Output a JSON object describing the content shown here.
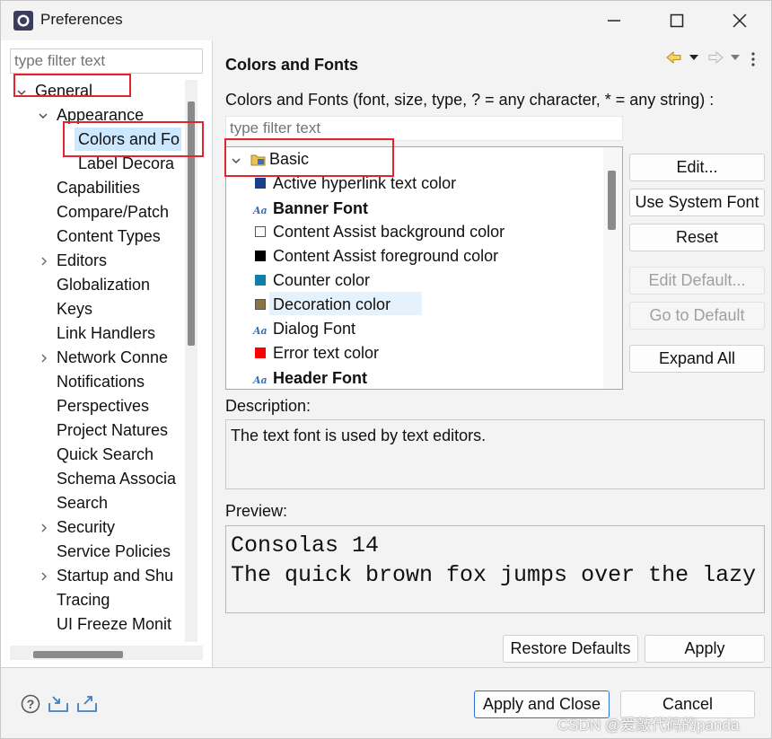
{
  "window": {
    "title": "Preferences"
  },
  "left": {
    "filter_placeholder": "type filter text",
    "tree": [
      {
        "label": "General"
      },
      {
        "label": "Appearance"
      },
      {
        "label": "Colors and Fo"
      },
      {
        "label": "Label Decora"
      },
      {
        "label": "Capabilities"
      },
      {
        "label": "Compare/Patch"
      },
      {
        "label": "Content Types"
      },
      {
        "label": "Editors"
      },
      {
        "label": "Globalization"
      },
      {
        "label": "Keys"
      },
      {
        "label": "Link Handlers"
      },
      {
        "label": "Network Conne"
      },
      {
        "label": "Notifications"
      },
      {
        "label": "Perspectives"
      },
      {
        "label": "Project Natures"
      },
      {
        "label": "Quick Search"
      },
      {
        "label": "Schema Associa"
      },
      {
        "label": "Search"
      },
      {
        "label": "Security"
      },
      {
        "label": "Service Policies"
      },
      {
        "label": "Startup and Shu"
      },
      {
        "label": "Tracing"
      },
      {
        "label": "UI Freeze Monit"
      }
    ]
  },
  "main": {
    "title": "Colors and Fonts",
    "subtitle": "Colors and Fonts (font, size, type, ? = any character, * = any string) :",
    "filter_placeholder": "type filter text",
    "category": "Basic",
    "items": [
      {
        "label": "Active hyperlink text color",
        "kind": "color",
        "color": "#1b3f8f"
      },
      {
        "label": "Banner Font",
        "kind": "font",
        "bold": true
      },
      {
        "label": "Content Assist background color",
        "kind": "color",
        "color": "#ffffff"
      },
      {
        "label": "Content Assist foreground color",
        "kind": "color",
        "color": "#000000"
      },
      {
        "label": "Counter color",
        "kind": "color",
        "color": "#0f7fa8"
      },
      {
        "label": "Decoration color",
        "kind": "color",
        "color": "#8a7540",
        "selected": true
      },
      {
        "label": "Dialog Font",
        "kind": "font"
      },
      {
        "label": "Error text color",
        "kind": "color",
        "color": "#ff0000"
      },
      {
        "label": "Header Font",
        "kind": "font",
        "bold": true
      }
    ],
    "buttons": {
      "edit": "Edit...",
      "use_system_font": "Use System Font",
      "reset": "Reset",
      "edit_default": "Edit Default...",
      "go_to_default": "Go to Default",
      "expand_all": "Expand All"
    },
    "description_label": "Description:",
    "description_text": "The text font is used by text editors.",
    "preview_label": "Preview:",
    "preview_line1": "Consolas 14",
    "preview_line2": "The quick brown fox jumps over the lazy",
    "restore_defaults": "Restore Defaults",
    "apply": "Apply"
  },
  "bottom": {
    "apply_and_close": "Apply and Close",
    "cancel": "Cancel"
  },
  "watermark": "CSDN @爱敲代码的panda",
  "colors": {
    "accent": "#2a6fd6",
    "highlight": "#cce8ff",
    "annotation": "#e0252f"
  }
}
